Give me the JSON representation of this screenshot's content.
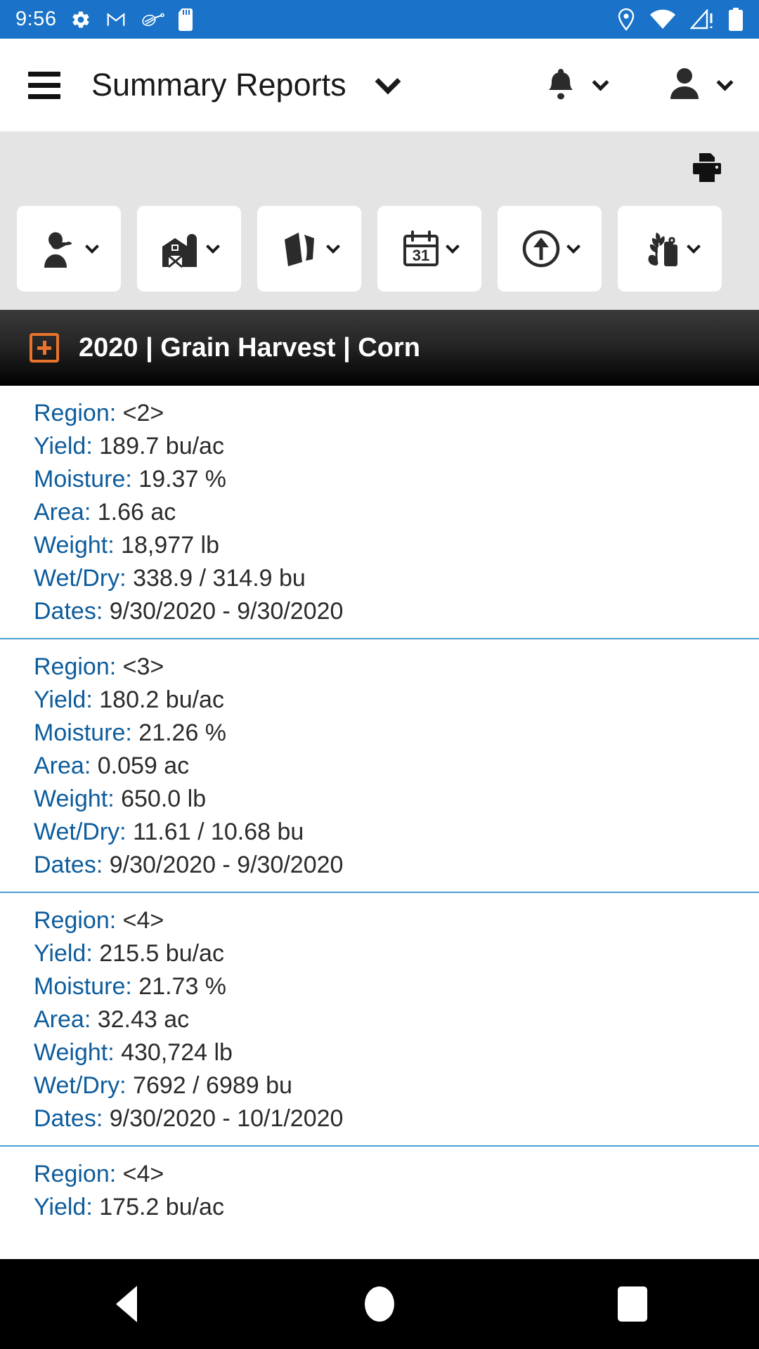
{
  "status_bar": {
    "time": "9:56",
    "left_icons": [
      "gear-icon",
      "gmail-icon",
      "fitness-icon",
      "sd-card-icon"
    ],
    "right_icons": [
      "location-pin-icon",
      "wifi-icon",
      "cellular-signal-warning-icon",
      "battery-full-icon"
    ],
    "background_color": "#1a73c8"
  },
  "app_bar": {
    "menu_icon": "hamburger-menu-icon",
    "title": "Summary Reports",
    "title_dropdown_icon": "chevron-down-icon",
    "notifications_icon": "bell-icon",
    "notifications_dropdown_icon": "chevron-down-icon",
    "account_icon": "user-icon",
    "account_dropdown_icon": "chevron-down-icon"
  },
  "toolbar": {
    "print_icon": "print-icon",
    "filters": [
      {
        "name": "grower-filter",
        "icon": "grower-person-icon"
      },
      {
        "name": "farm-filter",
        "icon": "barn-silo-icon"
      },
      {
        "name": "field-filter",
        "icon": "field-polygons-icon"
      },
      {
        "name": "season-filter",
        "icon": "calendar-31-icon"
      },
      {
        "name": "operation-filter",
        "icon": "circle-arrow-up-icon"
      },
      {
        "name": "crop-product-filter",
        "icon": "plant-jug-icon"
      }
    ],
    "filter_dropdown_icon": "chevron-down-icon",
    "background_color": "#e4e4e4"
  },
  "group_header": {
    "expand_icon": "plus-square-icon",
    "expand_icon_color": "#e8742c",
    "title": "2020 | Grain Harvest | Corn"
  },
  "labels": {
    "region": "Region:",
    "yield": "Yield:",
    "moisture": "Moisture:",
    "area": "Area:",
    "weight": "Weight:",
    "wet_dry": "Wet/Dry:",
    "dates": "Dates:"
  },
  "label_color": "#0d5c9c",
  "records": [
    {
      "region": "<2>",
      "yield": "189.7 bu/ac",
      "moisture": "19.37 %",
      "area": "1.66 ac",
      "weight": "18,977 lb",
      "wet_dry": "338.9 / 314.9 bu",
      "dates": "9/30/2020 - 9/30/2020"
    },
    {
      "region": "<3>",
      "yield": "180.2 bu/ac",
      "moisture": "21.26 %",
      "area": "0.059 ac",
      "weight": "650.0 lb",
      "wet_dry": "11.61 / 10.68 bu",
      "dates": "9/30/2020 - 9/30/2020"
    },
    {
      "region": "<4>",
      "yield": "215.5 bu/ac",
      "moisture": "21.73 %",
      "area": "32.43 ac",
      "weight": "430,724 lb",
      "wet_dry": "7692 / 6989 bu",
      "dates": "9/30/2020 - 10/1/2020"
    },
    {
      "region": "<4>",
      "yield": "175.2 bu/ac"
    }
  ],
  "nav_bar": {
    "back": "back-triangle-icon",
    "home": "home-circle-icon",
    "recents": "recents-square-icon"
  }
}
